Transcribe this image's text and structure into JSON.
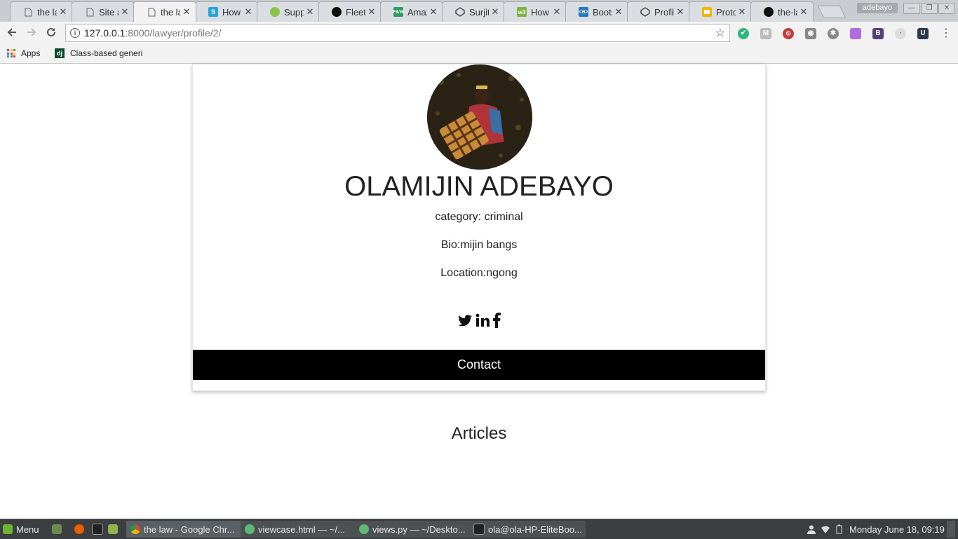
{
  "browser": {
    "tabs": [
      {
        "title": "the la",
        "icon": "page-icon"
      },
      {
        "title": "Site a",
        "icon": "page-icon"
      },
      {
        "title": "the la",
        "icon": "page-icon"
      },
      {
        "title": "How t",
        "icon": "stackoverflow-icon"
      },
      {
        "title": "Suppo",
        "icon": "android-icon"
      },
      {
        "title": "Fleeti",
        "icon": "github-icon"
      },
      {
        "title": "Amaz",
        "icon": "fw-icon"
      },
      {
        "title": "Surjit",
        "icon": "codepen-icon"
      },
      {
        "title": "How",
        "icon": "w3-icon"
      },
      {
        "title": "Boots",
        "icon": "bootsnipp-icon"
      },
      {
        "title": "Profil",
        "icon": "codepen-icon"
      },
      {
        "title": "Proto",
        "icon": "slides-icon"
      },
      {
        "title": "the-la",
        "icon": "github-icon"
      }
    ],
    "active_tab_index": 2,
    "profile_name": "adebayo",
    "window_controls": {
      "minimize": "—",
      "restore": "❐",
      "close": "✕"
    },
    "url_host": "127.0.0.1",
    "url_rest": ":8000/lawyer/profile/2/",
    "bookmarks": [
      {
        "label": "Apps"
      },
      {
        "label": "Class-based generi"
      }
    ]
  },
  "profile": {
    "name": "OLAMIJIN ADEBAYO",
    "category": "category: criminal",
    "bio": "Bio:mijin bangs",
    "location": "Location:ngong",
    "contact_label": "Contact"
  },
  "articles_heading": "Articles",
  "taskbar": {
    "menu_label": "Menu",
    "windows": [
      {
        "title": "the law - Google Chr..."
      },
      {
        "title": "viewcase.html — ~/..."
      },
      {
        "title": "views.py — ~/Deskto..."
      },
      {
        "title": "ola@ola-HP-EliteBoo..."
      }
    ],
    "clock": "Monday June 18, 09:19"
  }
}
